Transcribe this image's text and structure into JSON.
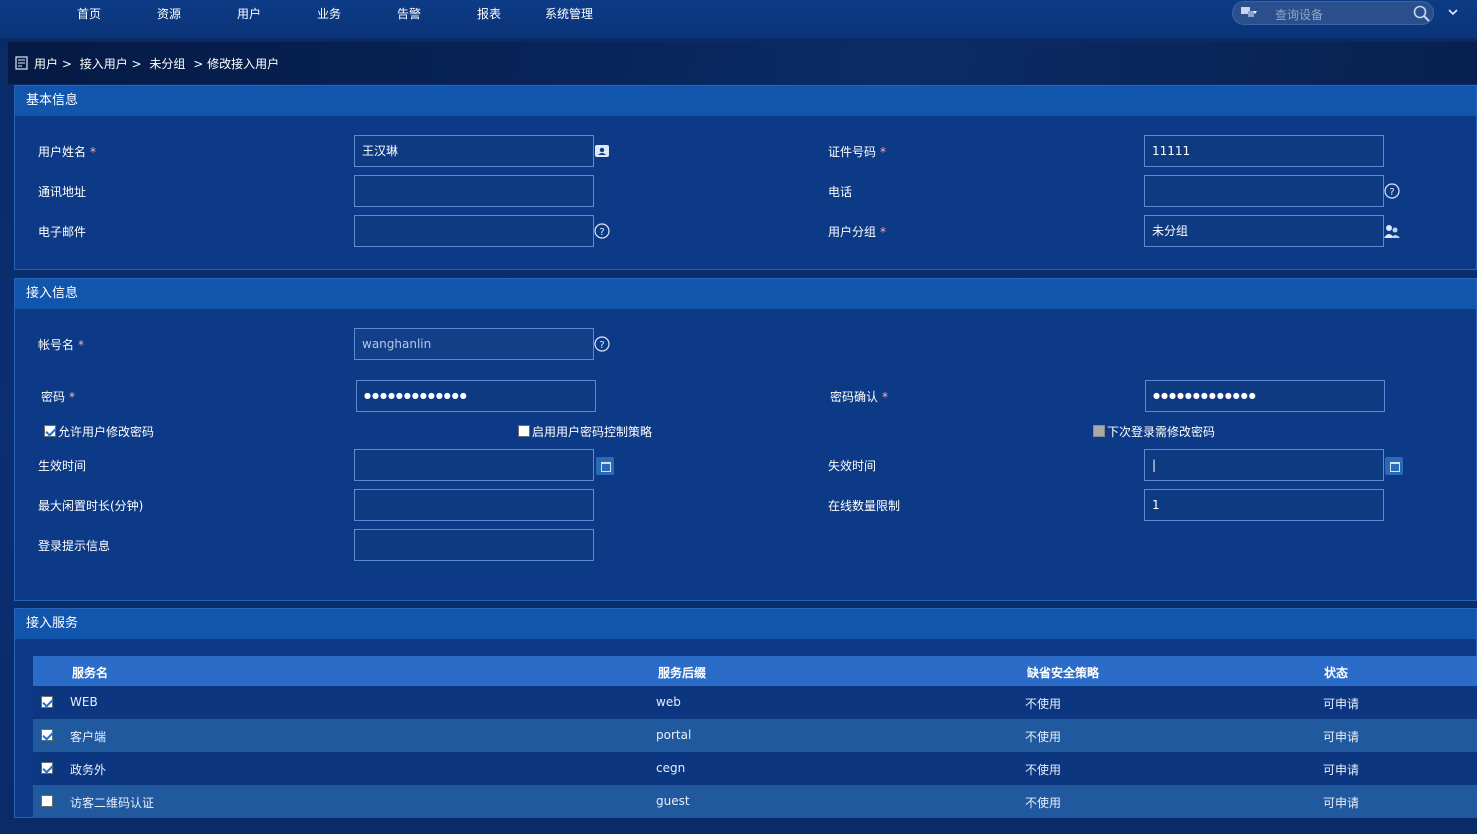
{
  "nav": [
    "首页",
    "资源",
    "用户",
    "业务",
    "告警",
    "报表",
    "系统管理"
  ],
  "search": {
    "placeholder": "查询设备"
  },
  "breadcrumb": [
    "用户 >",
    "接入用户 >",
    "未分组",
    "> 修改接入用户"
  ],
  "basic": {
    "title": "基本信息",
    "name_label": "用户姓名",
    "name_value": "王汉琳",
    "id_label": "证件号码",
    "id_value": "11111",
    "addr_label": "通讯地址",
    "addr_value": "",
    "phone_label": "电话",
    "phone_value": "",
    "email_label": "电子邮件",
    "email_value": "",
    "group_label": "用户分组",
    "group_value": "未分组",
    "required_mark": "*"
  },
  "access": {
    "title": "接入信息",
    "account_label": "帐号名",
    "account_value": "wanghanlin",
    "pwd_label": "密码",
    "pwd_value": "●●●●●●●●●●●●●",
    "pwd_confirm_label": "密码确认",
    "pwd_confirm_value": "●●●●●●●●●●●●●",
    "allow_change": "允许用户修改密码",
    "enable_policy": "启用用户密码控制策略",
    "next_login": "下次登录需修改密码",
    "effective_label": "生效时间",
    "effective_value": "",
    "expire_label": "失效时间",
    "expire_value": "|",
    "idle_label": "最大闲置时长(分钟)",
    "idle_value": "",
    "online_label": "在线数量限制",
    "online_value": "1",
    "tip_label": "登录提示信息",
    "tip_value": ""
  },
  "services": {
    "title": "接入服务",
    "columns": [
      "服务名",
      "服务后缀",
      "缺省安全策略",
      "状态"
    ],
    "rows": [
      {
        "checked": true,
        "name": "WEB",
        "suffix": "web",
        "policy": "不使用",
        "status": "可申请"
      },
      {
        "checked": true,
        "name": "客户端",
        "suffix": "portal",
        "policy": "不使用",
        "status": "可申请"
      },
      {
        "checked": true,
        "name": "政务外",
        "suffix": "cegn",
        "policy": "不使用",
        "status": "可申请"
      },
      {
        "checked": false,
        "name": "访客二维码认证",
        "suffix": "guest",
        "policy": "不使用",
        "status": "可申请"
      }
    ]
  }
}
